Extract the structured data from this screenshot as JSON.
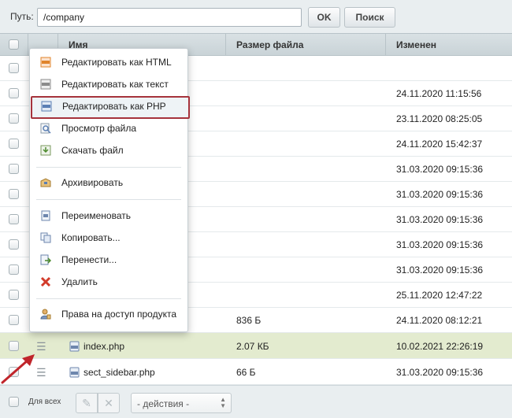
{
  "path_bar": {
    "label": "Путь:",
    "value": "/company",
    "ok_label": "OK",
    "search_label": "Поиск"
  },
  "grid": {
    "columns": {
      "name": "Имя",
      "size": "Размер файла",
      "date": "Изменен"
    },
    "rows": [
      {
        "name": "",
        "size": "",
        "date": ""
      },
      {
        "name": "",
        "size": "",
        "date": "24.11.2020 11:15:56"
      },
      {
        "name": "",
        "size": "",
        "date": "23.11.2020 08:25:05"
      },
      {
        "name": "",
        "size": "",
        "date": "24.11.2020 15:42:37"
      },
      {
        "name": "",
        "size": "",
        "date": "31.03.2020 09:15:36"
      },
      {
        "name": "",
        "size": "",
        "date": "31.03.2020 09:15:36"
      },
      {
        "name": "",
        "size": "",
        "date": "31.03.2020 09:15:36"
      },
      {
        "name": "",
        "size": "",
        "date": "31.03.2020 09:15:36"
      },
      {
        "name": "",
        "size": "",
        "date": "31.03.2020 09:15:36"
      },
      {
        "name": "",
        "size": "",
        "date": "25.11.2020 12:47:22"
      },
      {
        "name": "",
        "size": "836 Б",
        "date": "24.11.2020 08:12:21"
      },
      {
        "name": "index.php",
        "size": "2.07 КБ",
        "date": "10.02.2021 22:26:19"
      },
      {
        "name": "sect_sidebar.php",
        "size": "66 Б",
        "date": "31.03.2020 09:15:36"
      }
    ]
  },
  "context_menu": {
    "items": [
      {
        "label": "Редактировать как HTML",
        "icon": "html-edit-icon"
      },
      {
        "label": "Редактировать как текст",
        "icon": "text-edit-icon"
      },
      {
        "label": "Редактировать как PHP",
        "icon": "php-edit-icon"
      },
      {
        "label": "Просмотр файла",
        "icon": "view-file-icon"
      },
      {
        "label": "Скачать файл",
        "icon": "download-icon"
      },
      {
        "label": "Архивировать",
        "icon": "archive-icon"
      },
      {
        "label": "Переименовать",
        "icon": "rename-icon"
      },
      {
        "label": "Копировать...",
        "icon": "copy-icon"
      },
      {
        "label": "Перенести...",
        "icon": "move-icon"
      },
      {
        "label": "Удалить",
        "icon": "delete-icon"
      },
      {
        "label": "Права на доступ продукта",
        "icon": "access-rights-icon"
      }
    ]
  },
  "footer": {
    "all_label": "Для всех",
    "actions_value": "- действия -"
  },
  "colors": {
    "selected_row": "#e3ebcf",
    "highlight_border": "#a6333c",
    "pointer_arrow": "#c0252b"
  }
}
